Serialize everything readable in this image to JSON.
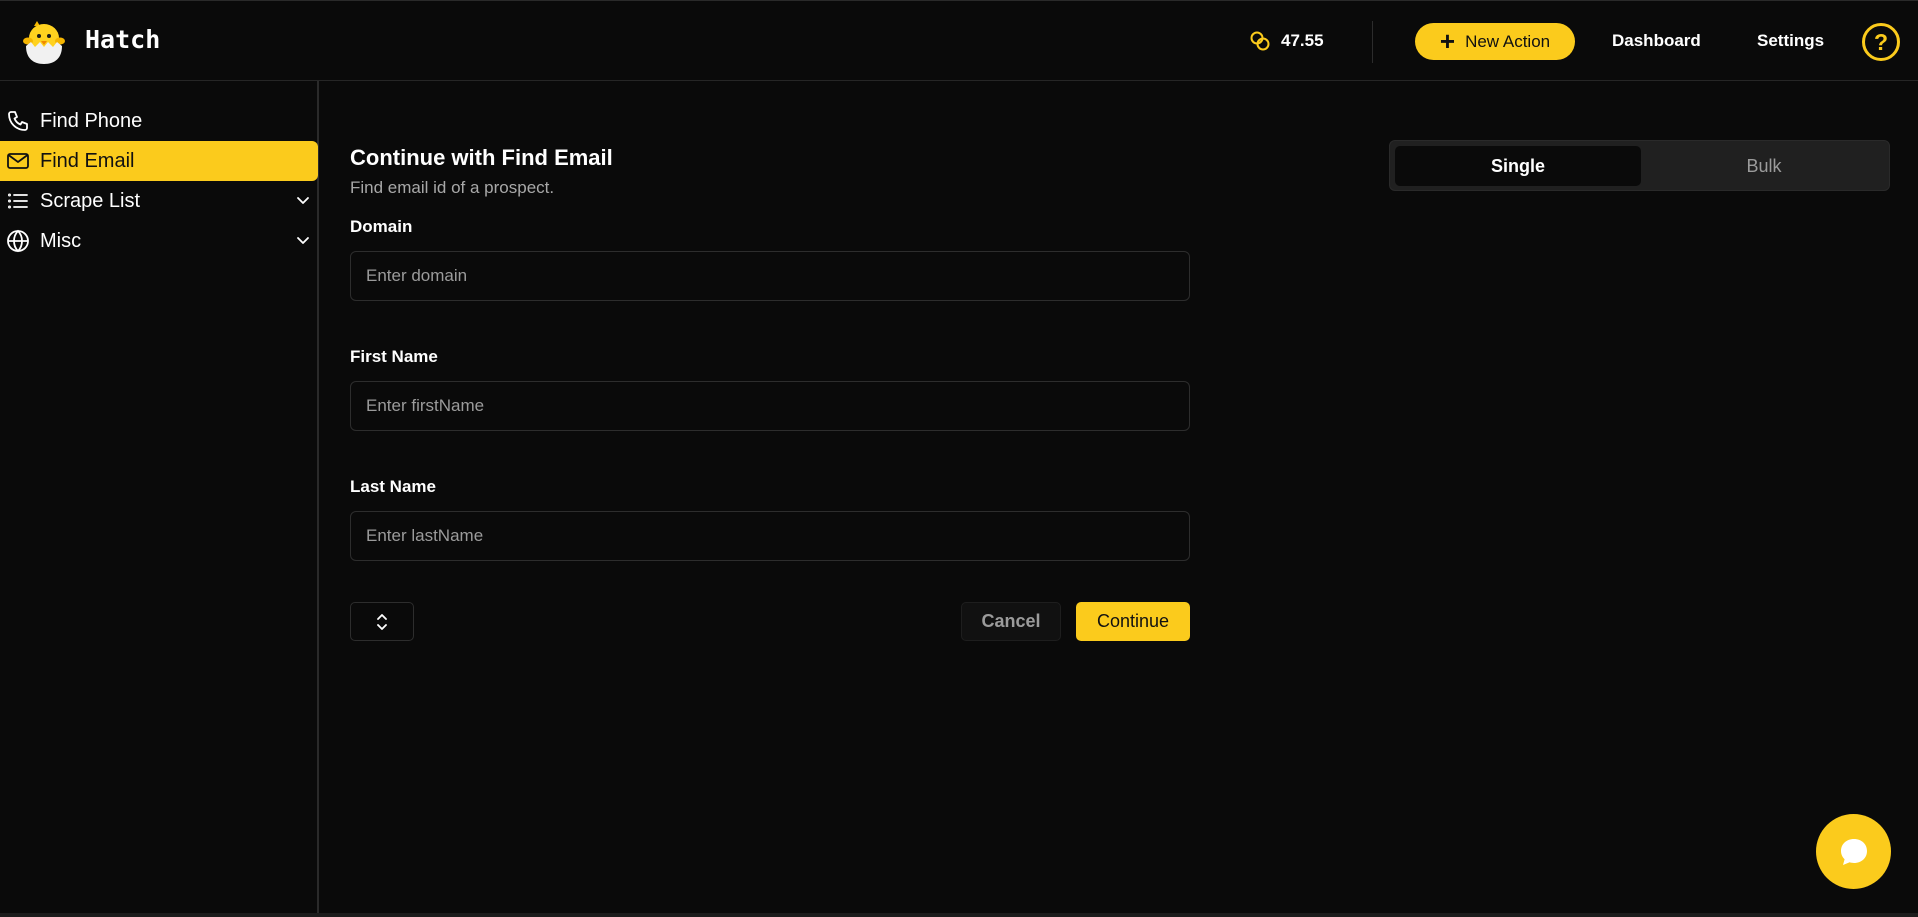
{
  "app": {
    "brand": "Hatch"
  },
  "header": {
    "credits": "47.55",
    "new_action_label": "New Action",
    "dashboard_label": "Dashboard",
    "settings_label": "Settings",
    "help_label": "?"
  },
  "sidebar": {
    "items": [
      {
        "label": "Find Phone",
        "icon": "phone-icon",
        "active": false
      },
      {
        "label": "Find Email",
        "icon": "mail-icon",
        "active": true
      },
      {
        "label": "Scrape List",
        "icon": "list-icon",
        "active": false,
        "expandable": true
      },
      {
        "label": "Misc",
        "icon": "globe-icon",
        "active": false,
        "expandable": true
      }
    ]
  },
  "main": {
    "title": "Continue with Find Email",
    "subtitle": "Find email id of a prospect.",
    "fields": [
      {
        "label": "Domain",
        "placeholder": "Enter domain",
        "value": ""
      },
      {
        "label": "First Name",
        "placeholder": "Enter firstName",
        "value": ""
      },
      {
        "label": "Last Name",
        "placeholder": "Enter lastName",
        "value": ""
      }
    ],
    "cancel_label": "Cancel",
    "continue_label": "Continue"
  },
  "mode_toggle": {
    "options": [
      "Single",
      "Bulk"
    ],
    "selected": "Single"
  },
  "colors": {
    "accent": "#fbcb1c",
    "background": "#0a0a0a",
    "border": "#2d2d2d",
    "muted_text": "#9b9b9b"
  }
}
